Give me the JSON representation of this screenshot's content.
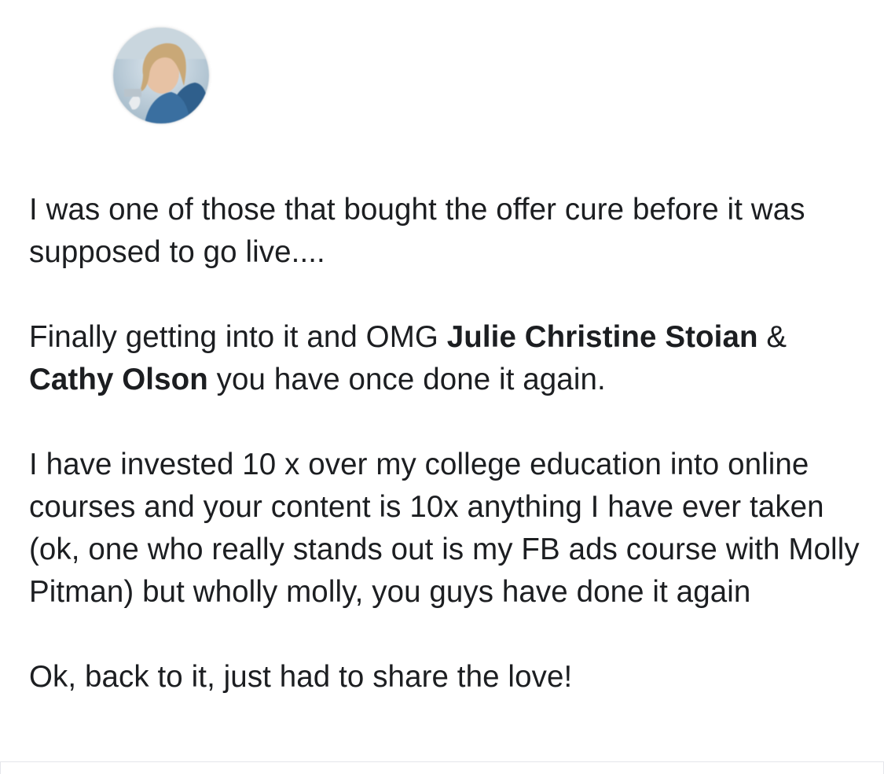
{
  "post": {
    "paragraph_1": "I was one of those that bought the offer cure before it was supposed to go live....",
    "paragraph_2": {
      "prefix": "Finally getting into it and OMG ",
      "mention_1": "Julie Christine Stoian",
      "joiner": " & ",
      "mention_2": "Cathy Olson",
      "suffix": " you have once done it again."
    },
    "paragraph_3": "I have invested 10 x over my college education into online courses and your content is 10x anything I have ever taken (ok, one who really stands out is my FB ads course with Molly Pitman) but wholly molly, you guys have done it again",
    "paragraph_4": "Ok, back to it, just had to share the love!"
  },
  "colors": {
    "text": "#1c1e21",
    "divider": "#e4e6eb"
  }
}
